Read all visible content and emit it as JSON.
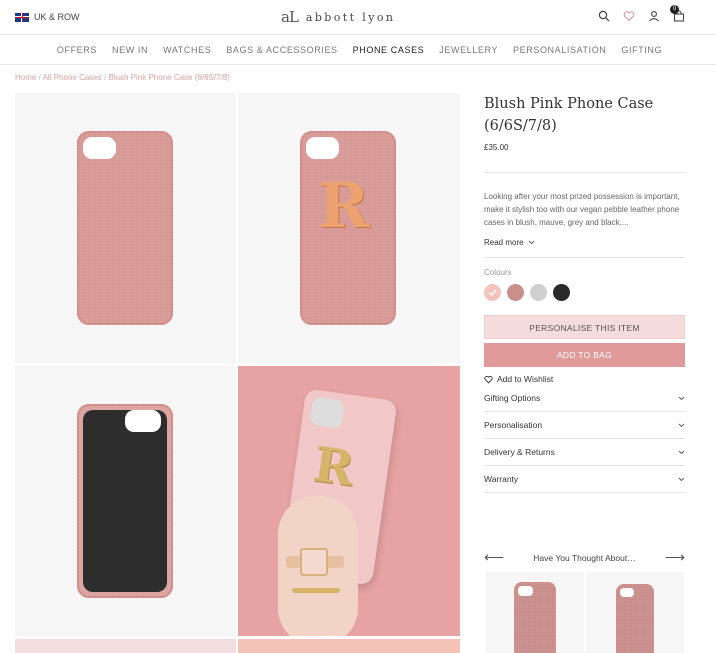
{
  "header": {
    "region_label": "UK & ROW",
    "logo_mark": "aL",
    "logo_text": "abbott lyon",
    "bag_count": "0"
  },
  "nav": {
    "items": [
      "OFFERS",
      "NEW IN",
      "WATCHES",
      "BAGS & ACCESSORIES",
      "PHONE CASES",
      "JEWELLERY",
      "PERSONALISATION",
      "GIFTING"
    ],
    "active": "PHONE CASES"
  },
  "breadcrumb": {
    "home": "Home",
    "category": "All Phone Cases",
    "current": "Blush Pink Phone Case (6/6S/7/8)",
    "separator": "/"
  },
  "gallery": {
    "monogram_letter": "R"
  },
  "product": {
    "title_line1": "Blush Pink Phone Case",
    "title_line2": "(6/6S/7/8)",
    "price": "£35.00",
    "description": "Looking after your most prized possession is important, make it stylish too with our vegan pebble leather phone cases in blush, mauve, grey and black....",
    "read_more": "Read more",
    "colours_label": "Colours",
    "colours": [
      "#f3c4bd",
      "#c98f8c",
      "#cfcfcf",
      "#2a2a2a"
    ],
    "selected_colour_index": 0,
    "personalise_label": "PERSONALISE THIS ITEM",
    "add_to_bag_label": "ADD TO BAG",
    "wishlist_label": "Add to Wishlist"
  },
  "accordions": [
    "Gifting Options",
    "Personalisation",
    "Delivery & Returns",
    "Warranty"
  ],
  "related": {
    "title": "Have You Thought About…"
  },
  "colors": {
    "accent_pink": "#e09a99",
    "case_pink": "#d79a97"
  }
}
